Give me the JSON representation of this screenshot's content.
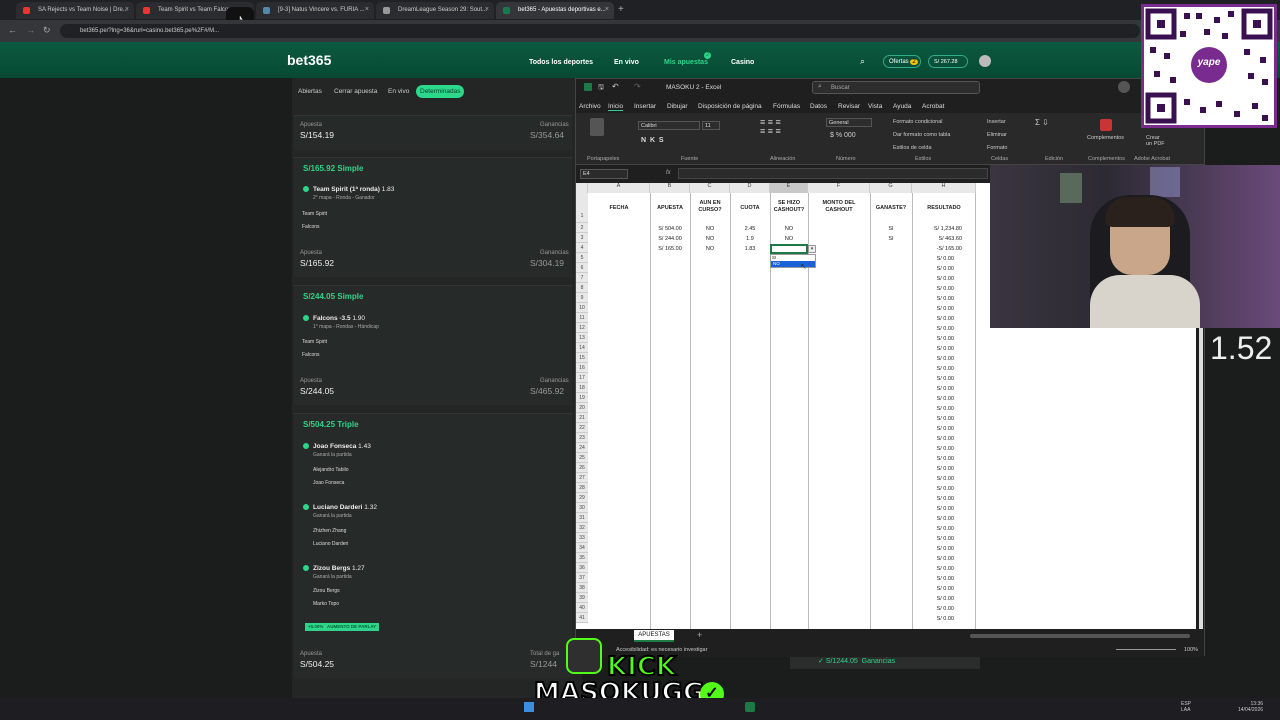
{
  "browser": {
    "tabs": [
      {
        "label": "SA Rejects vs Team Noise | Dre..."
      },
      {
        "label": "Team Spirit vs Team Falcons"
      },
      {
        "label": "[9-3] Natus Vincere vs. FURIA ..."
      },
      {
        "label": "DreamLeague Season 29: Sout..."
      },
      {
        "label": "bet365 - Apuestas deportivas e..."
      }
    ],
    "url": "bet365.pe/?lng=36&rurl=casino.bet365.pe%2F#/M..."
  },
  "bet365": {
    "logo": "bet365",
    "nav": [
      "Todos los deportes",
      "En vivo",
      "Mis apuestas",
      "Casino"
    ],
    "mis_apuestas_badge": "2",
    "ofertas": "Ofertas",
    "ofertas_badge": "2",
    "balance": "S/ 267.28",
    "filters": [
      "Abiertas",
      "Cerrar apuesta",
      "En vivo",
      "Determinadas"
    ],
    "card0": {
      "apuesta_label": "Apuesta",
      "apuesta": "S/154.19",
      "ganancias_label": "Ganancias",
      "ganancias": "S/354.64"
    },
    "card1": {
      "title": "S/165.92 Simple",
      "selection": "Team Spirit (1ª ronda)",
      "odds": "1.83",
      "market": "2° mapa - Ronda - Ganador",
      "team1": "Team Spirit",
      "team2": "Falcons",
      "apuesta_label": "Apuesta",
      "apuesta": "S/165.92",
      "ganancias_label": "Ganancias",
      "ganancias": "S/304.19"
    },
    "card2": {
      "title": "S/244.05 Simple",
      "selection": "Falcons -3.5",
      "odds": "1.90",
      "market": "1° mapa - Rondas - Hándicap",
      "team1": "Team Spirit",
      "team2": "Falcons",
      "apuesta_label": "Apuesta",
      "apuesta": "S/244.05",
      "ganancias_label": "Ganancias",
      "ganancias": "S/465.92"
    },
    "card3": {
      "title": "S/504.25 Triple",
      "legs": [
        {
          "selection": "Joao Fonseca",
          "odds": "1.43",
          "market": "Ganará la partida",
          "p1": "Alejandro Tabilo",
          "p2": "Joao Fonseca"
        },
        {
          "selection": "Luciano Darderi",
          "odds": "1.32",
          "market": "Ganará la partida",
          "p1": "Zhizhen Zhang",
          "p2": "Luciano Darderi"
        },
        {
          "selection": "Zizou Bergs",
          "odds": "1.27",
          "market": "Ganará la partida",
          "p1": "Zizou Bergs",
          "p2": "Marko Topo"
        }
      ],
      "boost": "+5.00%",
      "boost_label": "AUMENTO DE PARLAY",
      "apuesta_label": "Apuesta",
      "apuesta": "S/504.25",
      "total_label": "Total de ga",
      "total": "S/1244",
      "footer_amount": "S/1244.05",
      "footer_label": "Ganancias"
    }
  },
  "excel": {
    "title": "MASOKU 2 - Excel",
    "search": "Buscar",
    "menu": [
      "Archivo",
      "Inicio",
      "Insertar",
      "Dibujar",
      "Disposición de página",
      "Fórmulas",
      "Datos",
      "Revisar",
      "Vista",
      "Ayuda",
      "Acrobat"
    ],
    "ribbon": {
      "font": "Calibri",
      "size": "11",
      "number_format": "General",
      "groups": [
        "Portapapeles",
        "Fuente",
        "Alineación",
        "Número",
        "Estilos",
        "Celdas",
        "Edición",
        "Complementos",
        "Adobe Acrobat"
      ],
      "styles": [
        "Formato condicional",
        "Dar formato como tabla",
        "Estilos de celda"
      ],
      "cells": [
        "Insertar",
        "Eliminar",
        "Formato"
      ],
      "complementos": "Complementos",
      "crear_pdf": "Crear un PDF"
    },
    "namebox": "E4",
    "fx": "fx",
    "columns": [
      "A",
      "B",
      "C",
      "D",
      "E",
      "F",
      "G",
      "H"
    ],
    "headers": [
      "FECHA",
      "APUESTA",
      "AUN EN CURSO?",
      "CUOTA",
      "SE HIZO CASHOUT?",
      "MONTO DEL CASHOUT",
      "GANASTE?",
      "RESULTADO"
    ],
    "rows": [
      {
        "apuesta": "S/ 504.00",
        "curso": "NO",
        "cuota": "2.45",
        "cashout": "NO",
        "ganaste": "SI",
        "resultado": "S/ 1,234.80"
      },
      {
        "apuesta": "S/ 244.00",
        "curso": "NO",
        "cuota": "1.9",
        "cashout": "NO",
        "ganaste": "SI",
        "resultado": "S/ 463.60"
      },
      {
        "apuesta": "S/ 165.00",
        "curso": "NO",
        "cuota": "1.83",
        "cashout": "",
        "ganaste": "",
        "resultado": "-S/ 165.00"
      }
    ],
    "dropdown": [
      "SI",
      "NO"
    ],
    "zero": "S/ 0.00",
    "row_numbers": [
      "1",
      "2",
      "3",
      "4",
      "5",
      "6",
      "7",
      "8",
      "9",
      "10",
      "11",
      "12",
      "13",
      "14",
      "15",
      "16",
      "17",
      "18",
      "19",
      "20",
      "21",
      "22",
      "23",
      "24",
      "25",
      "26",
      "27",
      "28",
      "29",
      "30",
      "31",
      "32",
      "33",
      "34",
      "35",
      "36",
      "37",
      "38",
      "39",
      "40",
      "41"
    ],
    "sheet_tab": "APUESTAS",
    "status": "Accesibilidad: es necesario investigar",
    "zoom": "100%"
  },
  "overlay": {
    "ratio": "1.52",
    "kick": "KICK",
    "channel": "MASOKUGG",
    "qr_brand": "yape"
  },
  "taskbar": {
    "lang1": "ESP",
    "lang2": "LAA",
    "time": "13:36",
    "date": "14/04/2026"
  }
}
